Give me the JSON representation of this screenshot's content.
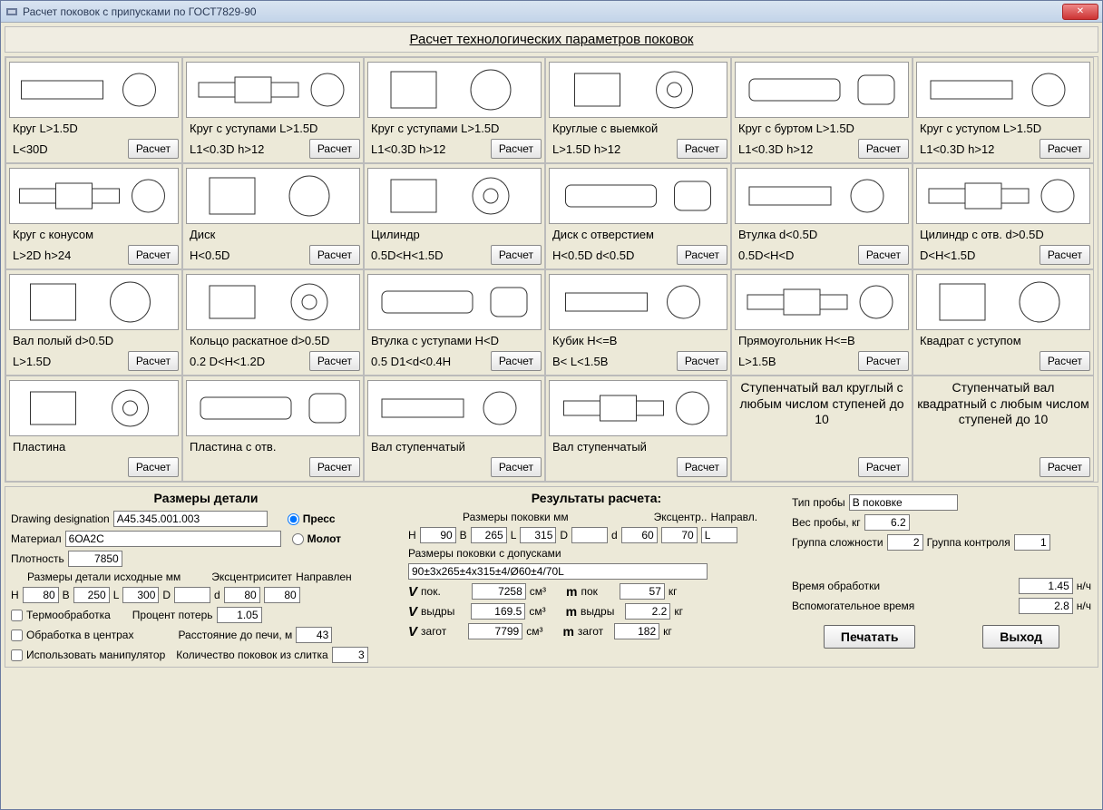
{
  "window": {
    "title": "Расчет поковок с припусками по ГОСТ7829-90"
  },
  "subtitle": "Расчет технологических параметров поковок",
  "btn_calc": "Расчет",
  "shapes": [
    [
      {
        "t1": "Круг       L>1.5D",
        "t2": "L<30D"
      },
      {
        "t1": "Круг с  уступами  L>1.5D",
        "t2": "L1<0.3D   h>12"
      },
      {
        "t1": "Круг с  уступами   L>1.5D",
        "t2": "L1<0.3D   h>12"
      },
      {
        "t1": "Круглые с выемкой",
        "t2": "L>1.5D    h>12"
      },
      {
        "t1": "Круг с буртом     L>1.5D",
        "t2": "L1<0.3D   h>12"
      },
      {
        "t1": "Круг с уступом    L>1.5D",
        "t2": "L1<0.3D   h>12"
      }
    ],
    [
      {
        "t1": "Круг с конусом",
        "t2": "L>2D      h>24"
      },
      {
        "t1": "Диск",
        "t2": "H<0.5D"
      },
      {
        "t1": "Цилиндр",
        "t2": "0.5D<H<1.5D"
      },
      {
        "t1": "Диск с отверстием",
        "t2": "H<0.5D   d<0.5D"
      },
      {
        "t1": "Втулка      d<0.5D",
        "t2": "0.5D<H<D"
      },
      {
        "t1": "Цилиндр с отв.   d>0.5D",
        "t2": "D<H<1.5D"
      }
    ],
    [
      {
        "t1": "Вал  полый    d>0.5D",
        "t2": "L>1.5D"
      },
      {
        "t1": "Кольцо раскатное  d>0.5D",
        "t2": "0.2 D<H<1.2D"
      },
      {
        "t1": "Втулка с уступами   H<D",
        "t2": "0.5 D1<d<0.4H"
      },
      {
        "t1": "Кубик          H<=B",
        "t2": "B< L<1.5B"
      },
      {
        "t1": "Прямоугольник   H<=B",
        "t2": "L>1.5B"
      },
      {
        "t1": "Квадрат с уступом",
        "t2": ""
      }
    ],
    [
      {
        "t1": "Пластина",
        "t2": ""
      },
      {
        "t1": "Пластина с отв.",
        "t2": ""
      },
      {
        "t1": "Вал ступенчатый",
        "t2": ""
      },
      {
        "t1": "Вал ступенчатый",
        "t2": ""
      },
      {
        "big": "Ступенчатый вал круглый с любым числом ступеней  до 10"
      },
      {
        "big": "Ступенчатый вал квадратный  с любым числом ступеней до 10"
      }
    ]
  ],
  "panel": {
    "det_header": "Размеры детали",
    "designation_lbl": "Drawing designation",
    "designation": "A45.345.001.003",
    "material_lbl": "Материал",
    "material": "6ОА2С",
    "density_lbl": "Плотность",
    "density": "7850",
    "src_dims_lbl": "Размеры детали исходные   мм",
    "ecc_lbl": "Эксцентриситет",
    "dir_lbl": "Направлен",
    "H_lbl": "H",
    "B_lbl": "B",
    "L_lbl": "L",
    "D_lbl": "D",
    "d_lbl": "d",
    "H": "80",
    "B": "250",
    "L": "300",
    "D": "",
    "d": "80",
    "d2": "80",
    "heat_lbl": "Термообработка",
    "loss_lbl": "Процент потерь",
    "loss": "1.05",
    "centers_lbl": "Обработка в центрах",
    "dist_lbl": "Расстояние до печи,  м",
    "dist": "43",
    "manip_lbl": "Использовать манипулятор",
    "ingot_lbl": "Количество поковок из слитка",
    "ingot": "3",
    "press_lbl": "Пресс",
    "hammer_lbl": "Молот",
    "res_header": "Результаты расчета:",
    "forging_dims_lbl": "Размеры поковки   мм",
    "ecc2_lbl": "Эксцентр..",
    "dir2_lbl": "Направл.",
    "Hf": "90",
    "Bf": "265",
    "Lf": "315",
    "Df": "",
    "df": "60",
    "df2": "70",
    "dir2": "L",
    "tol_lbl": "Размеры поковки с допусками",
    "tol": "90±3x265±4x315±4/Ø60±4/70L",
    "V_lbl": "V",
    "pok_lbl": "пок.",
    "vydry_lbl": "выдры",
    "zagot_lbl": "загот",
    "Vpok": "7258",
    "Vvyd": "169.5",
    "Vzag": "7799",
    "cm3": "см³",
    "m_lbl": "m",
    "mpok_lbl": "пок",
    "mvyd_lbl": "выдры",
    "mzag_lbl": "загот",
    "mpok": "57",
    "mvyd": "2.2",
    "mzag": "182",
    "kg": "кг",
    "probe_lbl": "Тип пробы",
    "probe": "В поковке",
    "probe_wt_lbl": "Вес пробы, кг",
    "probe_wt": "6.2",
    "grp_diff_lbl": "Группа сложности",
    "grp_diff": "2",
    "grp_ctrl_lbl": "Группа контроля",
    "grp_ctrl": "1",
    "proc_time_lbl": "Время обработки",
    "proc_time": "1.45",
    "nh": "н/ч",
    "aux_time_lbl": "Вспомогательное время",
    "aux_time": "2.8",
    "print": "Печатать",
    "exit": "Выход"
  }
}
